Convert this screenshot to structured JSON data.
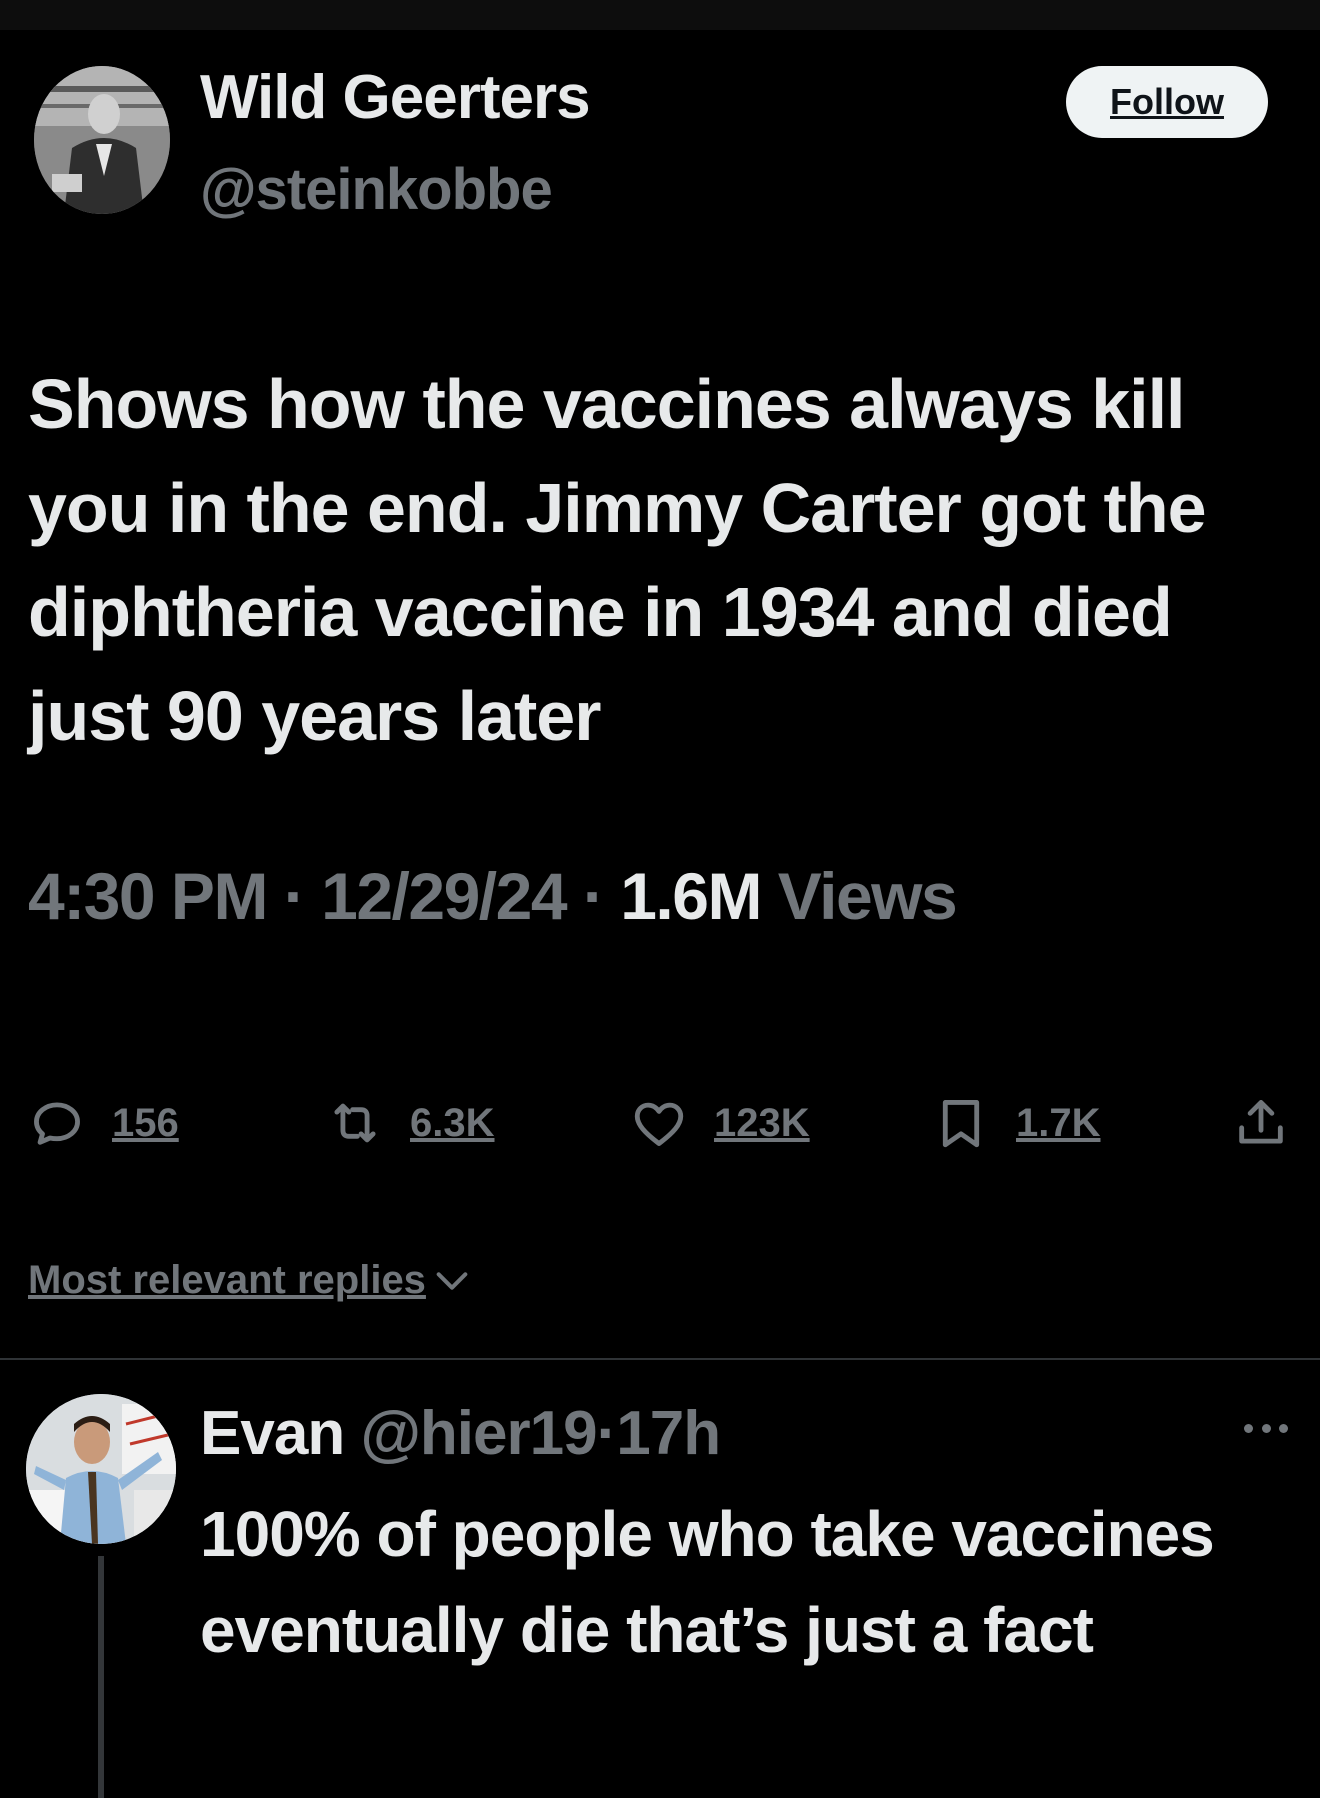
{
  "tweet": {
    "author_name": "Wild Geerters",
    "author_handle": "@steinkobbe",
    "follow_label": "Follow",
    "text": "Shows how the vaccines always kill you in the end. Jimmy Carter got the diphtheria vaccine in 1934 and died just 90 years later",
    "time": "4:30 PM",
    "separator": "·",
    "date": "12/29/24",
    "views_count": "1.6M",
    "views_label": "Views"
  },
  "actions": {
    "replies": {
      "icon": "reply-icon",
      "count": "156"
    },
    "reposts": {
      "icon": "repost-icon",
      "count": "6.3K"
    },
    "likes": {
      "icon": "heart-icon",
      "count": "123K"
    },
    "bookmarks": {
      "icon": "bookmark-icon",
      "count": "1.7K"
    },
    "share": {
      "icon": "share-icon"
    }
  },
  "replies_sort": {
    "label": "Most relevant replies",
    "icon": "chevron-down-icon"
  },
  "reply": {
    "name": "Evan",
    "handle": "@hier19",
    "separator": "·",
    "time": "17h",
    "text": "100% of people who take vaccines eventually die that’s just a fact",
    "more_icon": "more-icon"
  },
  "colors": {
    "background": "#000000",
    "primary_text": "#e7e9ea",
    "secondary_text": "#71767b",
    "button_bg": "#eff3f4"
  }
}
